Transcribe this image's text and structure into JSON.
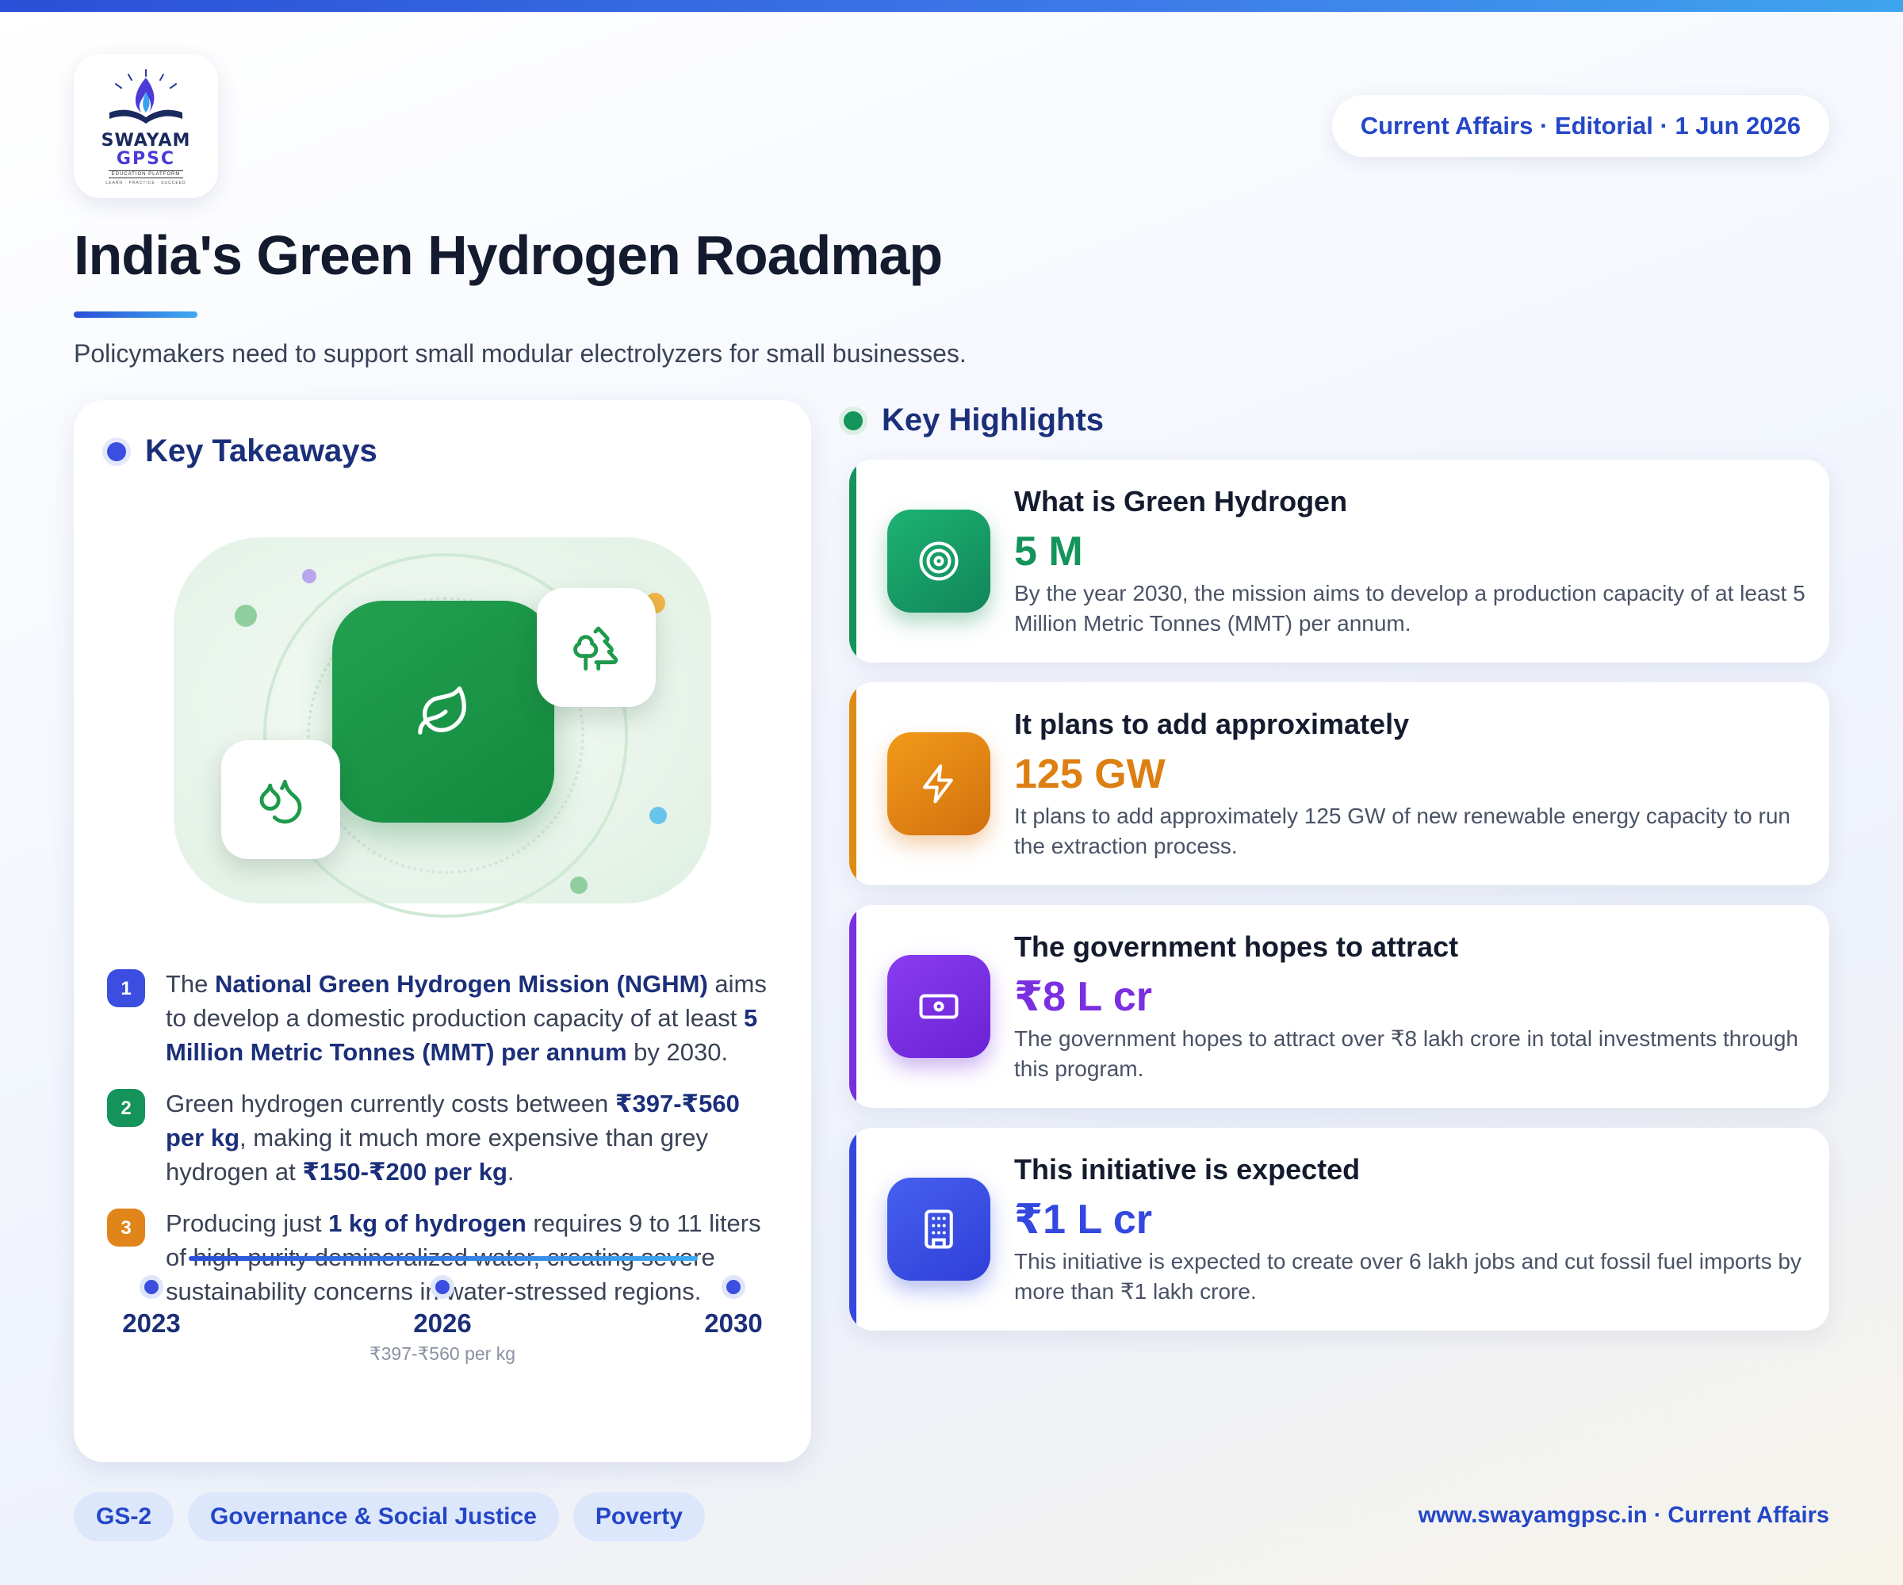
{
  "brand": {
    "line1": "SWAYAM",
    "line2": "GPSC",
    "line3": "EDUCATION PLATFORM",
    "line4": "LEARN · PRACTICE · SUCCEED"
  },
  "header": {
    "meta": "Current Affairs · Editorial · 1 Jun 2026"
  },
  "title": "India's Green Hydrogen Roadmap",
  "subtitle": "Policymakers need to support small modular electrolyzers for small businesses.",
  "takeaways": {
    "heading": "Key Takeaways",
    "items": [
      {
        "num": "1",
        "p1": "The ",
        "b1": "National Green Hydrogen Mission (NGHM)",
        "p2": " aims to develop a domestic production capacity of at least ",
        "b2": "5 Million Metric Tonnes (MMT) per annum",
        "p3": " by 2030.",
        "color": "#3b4ee0"
      },
      {
        "num": "2",
        "p1": "Green hydrogen currently costs between ",
        "b1": "₹397-₹560 per kg",
        "p2": ", making it much more expensive than grey hydrogen at ",
        "b2": "₹150-₹200 per kg",
        "p3": ".",
        "color": "#14935a"
      },
      {
        "num": "3",
        "p1": "Producing just ",
        "b1": "1 kg of hydrogen",
        "p2": " requires 9 to 11 liters of high-purity demineralized water, creating severe sustainability concerns in water-stressed regions.",
        "b2": "",
        "p3": "",
        "color": "#e0851a"
      }
    ],
    "timeline": [
      {
        "year": "2023",
        "note": ""
      },
      {
        "year": "2026",
        "note": "₹397-₹560 per kg"
      },
      {
        "year": "2030",
        "note": ""
      }
    ]
  },
  "highlights": {
    "heading": "Key Highlights",
    "items": [
      {
        "title": "What is Green Hydrogen",
        "value": "5 M",
        "desc": "By the year 2030, the mission aims to develop a production capacity of at least 5 Million Metric Tonnes (MMT) per annum.",
        "icon": "target-icon",
        "color": "#14935a"
      },
      {
        "title": "It plans to add approximately",
        "value": "125 GW",
        "desc": "It plans to add approximately 125 GW of new renewable energy capacity to run the extraction process.",
        "icon": "lightning-icon",
        "color": "#dd7f12"
      },
      {
        "title": "The government hopes to attract",
        "value": "₹8 L cr",
        "desc": "The government hopes to attract over ₹8 lakh crore in total investments through this program.",
        "icon": "money-icon",
        "color": "#7a2fe0"
      },
      {
        "title": "This initiative is expected",
        "value": "₹1 L cr",
        "desc": "This initiative is expected to create over 6 lakh jobs and cut fossil fuel imports by more than ₹1 lakh crore.",
        "icon": "building-icon",
        "color": "#3448e0"
      }
    ]
  },
  "tags": [
    "GS-2",
    "Governance & Social Justice",
    "Poverty"
  ],
  "footer": "www.swayamgpsc.in · Current Affairs"
}
